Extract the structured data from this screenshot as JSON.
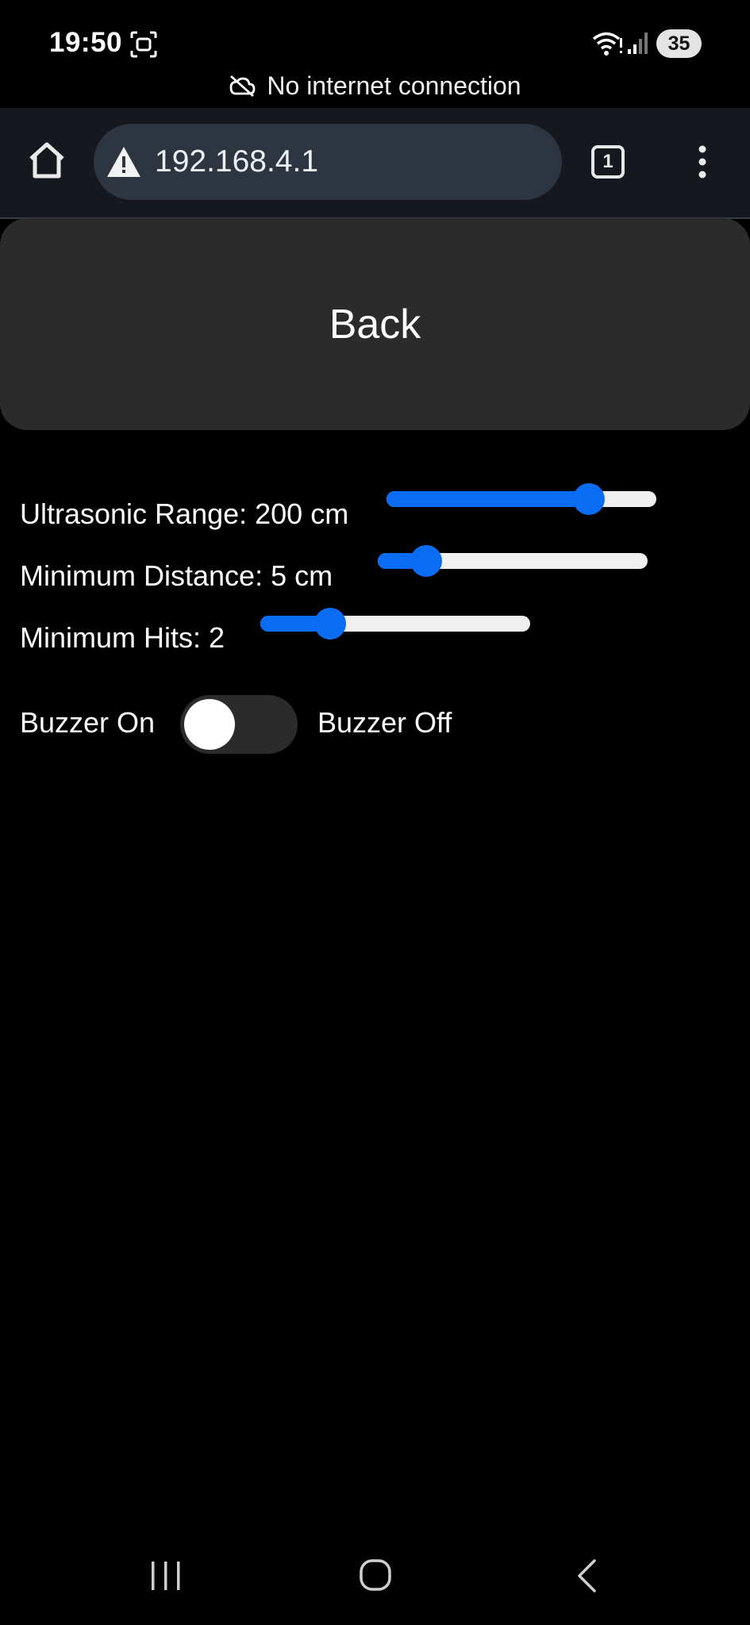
{
  "status_bar": {
    "time": "19:50",
    "battery": "35",
    "icons": [
      "screen-capture-icon",
      "wifi-icon",
      "signal-icon"
    ]
  },
  "connection_notice": {
    "text": "No internet connection",
    "icon": "cloud-off-icon"
  },
  "browser": {
    "url": "192.168.4.1",
    "tab_count": "1",
    "icons": [
      "home-icon",
      "warning-icon",
      "more-vert-icon"
    ]
  },
  "page": {
    "back_label": "Back",
    "settings": [
      {
        "label": "Ultrasonic Range: 200 cm",
        "value": 0.75
      },
      {
        "label": "Minimum Distance: 5 cm",
        "value": 0.18
      },
      {
        "label": "Minimum Hits: 2",
        "value": 0.26
      }
    ],
    "buzzer": {
      "on_label": "Buzzer On",
      "off_label": "Buzzer Off",
      "state": "off"
    }
  },
  "colors": {
    "accent": "#0a6cf2",
    "slider_track": "#efefef",
    "button_bg": "#2b2b2b",
    "toolbar_bg": "#15191f",
    "url_bar_bg": "#2d3640"
  },
  "nav": {
    "icons": [
      "recents-icon",
      "home-nav-icon",
      "back-nav-icon"
    ]
  }
}
